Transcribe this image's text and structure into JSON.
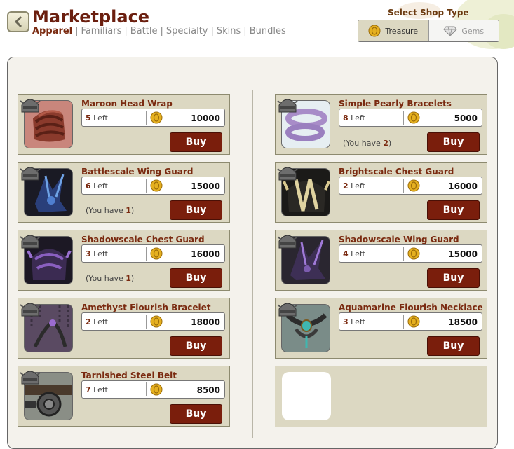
{
  "header": {
    "title": "Marketplace",
    "tabs": [
      {
        "label": "Apparel",
        "active": true
      },
      {
        "label": "Familiars",
        "active": false
      },
      {
        "label": "Battle",
        "active": false
      },
      {
        "label": "Specialty",
        "active": false
      },
      {
        "label": "Skins",
        "active": false
      },
      {
        "label": "Bundles",
        "active": false
      }
    ],
    "separator": "|"
  },
  "shop_type": {
    "label": "Select Shop Type",
    "options": [
      {
        "label": "Treasure",
        "icon": "treasure-coin-icon",
        "selected": true
      },
      {
        "label": "Gems",
        "icon": "gem-icon",
        "selected": false
      }
    ]
  },
  "items": [
    {
      "name": "Maroon Head Wrap",
      "left_count": "5",
      "left_suffix": " Left",
      "price": "10000",
      "buy_label": "Buy",
      "have_count": null,
      "icon": "maroon-head-wrap-icon"
    },
    {
      "name": "Battlescale Wing Guard",
      "left_count": "6",
      "left_suffix": " Left",
      "price": "15000",
      "buy_label": "Buy",
      "have_count": "1",
      "icon": "battlescale-wing-guard-icon"
    },
    {
      "name": "Shadowscale Chest Guard",
      "left_count": "3",
      "left_suffix": " Left",
      "price": "16000",
      "buy_label": "Buy",
      "have_count": "1",
      "icon": "shadowscale-chest-guard-icon"
    },
    {
      "name": "Amethyst Flourish Bracelet",
      "left_count": "2",
      "left_suffix": " Left",
      "price": "18000",
      "buy_label": "Buy",
      "have_count": null,
      "icon": "amethyst-flourish-bracelet-icon"
    },
    {
      "name": "Tarnished Steel Belt",
      "left_count": "7",
      "left_suffix": " Left",
      "price": "8500",
      "buy_label": "Buy",
      "have_count": null,
      "icon": "tarnished-steel-belt-icon"
    },
    {
      "name": "Simple Pearly Bracelets",
      "left_count": "8",
      "left_suffix": " Left",
      "price": "5000",
      "buy_label": "Buy",
      "have_count": "2",
      "icon": "simple-pearly-bracelets-icon"
    },
    {
      "name": "Brightscale Chest Guard",
      "left_count": "2",
      "left_suffix": " Left",
      "price": "16000",
      "buy_label": "Buy",
      "have_count": null,
      "icon": "brightscale-chest-guard-icon"
    },
    {
      "name": "Shadowscale Wing Guard",
      "left_count": "4",
      "left_suffix": " Left",
      "price": "15000",
      "buy_label": "Buy",
      "have_count": null,
      "icon": "shadowscale-wing-guard-icon"
    },
    {
      "name": "Aquamarine Flourish Necklace",
      "left_count": "3",
      "left_suffix": " Left",
      "price": "18500",
      "buy_label": "Buy",
      "have_count": null,
      "icon": "aquamarine-flourish-necklace-icon"
    }
  ],
  "have_text": {
    "prefix": "(You have ",
    "suffix": ")"
  },
  "colors": {
    "title": "#6b1f0f",
    "item_name": "#7a2a10",
    "buy_button": "#7a1e0c",
    "card_bg": "#dcd8c2",
    "coin": "#e5b020"
  }
}
